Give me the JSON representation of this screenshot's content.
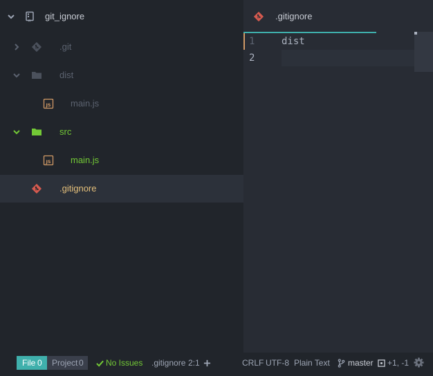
{
  "tree": {
    "root": {
      "label": "git_ignore",
      "icon": "repo-icon",
      "expanded": true
    },
    "items": [
      {
        "label": ".git",
        "icon": "git-icon",
        "type": "folder",
        "expanded": false,
        "color": "#5c6370"
      },
      {
        "label": "dist",
        "icon": "folder-icon",
        "type": "folder",
        "expanded": true,
        "color": "#5c6370"
      },
      {
        "label": "main.js",
        "icon": "js-file-icon",
        "type": "file",
        "color": "#5c6370"
      },
      {
        "label": "src",
        "icon": "folder-icon",
        "type": "folder",
        "expanded": true,
        "color": "#73c936"
      },
      {
        "label": "main.js",
        "icon": "js-file-icon",
        "type": "file",
        "color": "#73c936"
      },
      {
        "label": ".gitignore",
        "icon": "git-icon",
        "type": "file",
        "selected": true,
        "color": "#e5c07b"
      }
    ]
  },
  "editor": {
    "tab": {
      "title": ".gitignore",
      "icon": "git-icon"
    },
    "lines": [
      {
        "number": "1",
        "text": "dist"
      },
      {
        "number": "2",
        "text": ""
      }
    ]
  },
  "statusbar": {
    "file_label": "File",
    "file_count": "0",
    "project_label": "Project",
    "project_count": "0",
    "issues": "No Issues",
    "filename": ".gitignore",
    "position": "2:1",
    "line_ending": "CRLF",
    "encoding": "UTF-8",
    "grammar": "Plain Text",
    "branch": "master",
    "diff": "+1, -1"
  },
  "colors": {
    "accent": "#3fb0ac",
    "git_red": "#d55a4f",
    "js_orange": "#d19a66",
    "vcs_added": "#73c936",
    "vcs_modified": "#e5c07b",
    "ignored": "#5c6370"
  }
}
